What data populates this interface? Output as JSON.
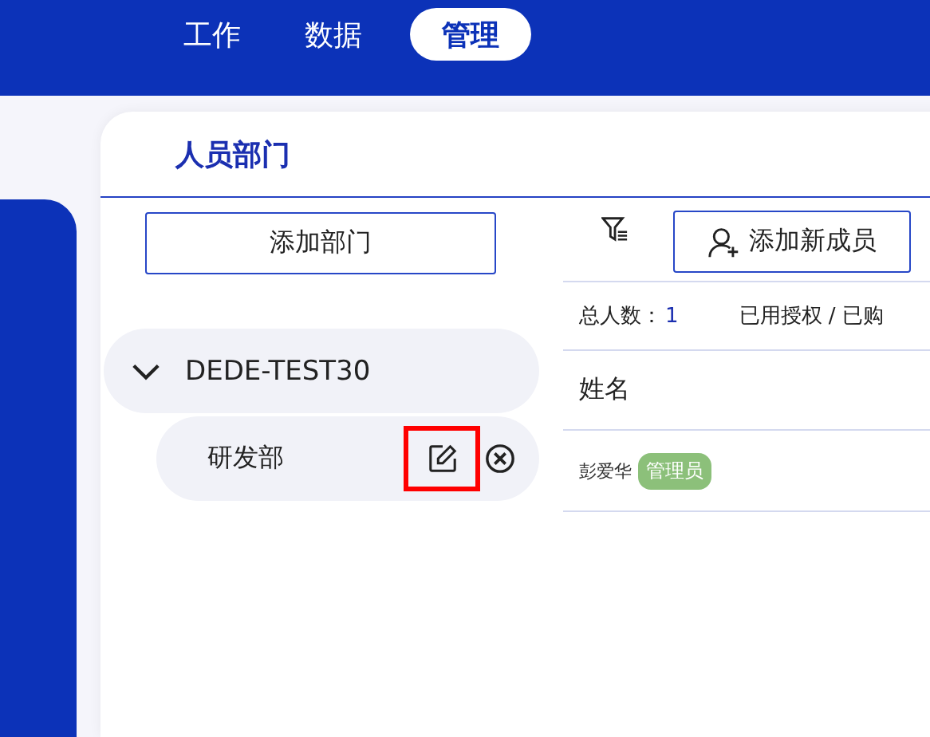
{
  "nav": {
    "tabs": [
      {
        "label": "工作",
        "selected": false
      },
      {
        "label": "数据",
        "selected": false
      },
      {
        "label": "管理",
        "selected": true
      }
    ]
  },
  "panel": {
    "title": "人员部门"
  },
  "departments": {
    "add_button": "添加部门",
    "tree": [
      {
        "name": "DEDE-TEST30",
        "expanded": true,
        "children": [
          {
            "name": "研发部",
            "edit_highlighted": true
          }
        ]
      }
    ]
  },
  "members": {
    "add_button": "添加新成员",
    "stats": [
      {
        "label": "总人数：",
        "value": "1"
      },
      {
        "label": "已用授权 / 已购"
      }
    ],
    "columns": [
      "姓名"
    ],
    "rows": [
      {
        "name": "彭爱华",
        "tag": "管理员",
        "color": "#8cc07a"
      }
    ]
  }
}
